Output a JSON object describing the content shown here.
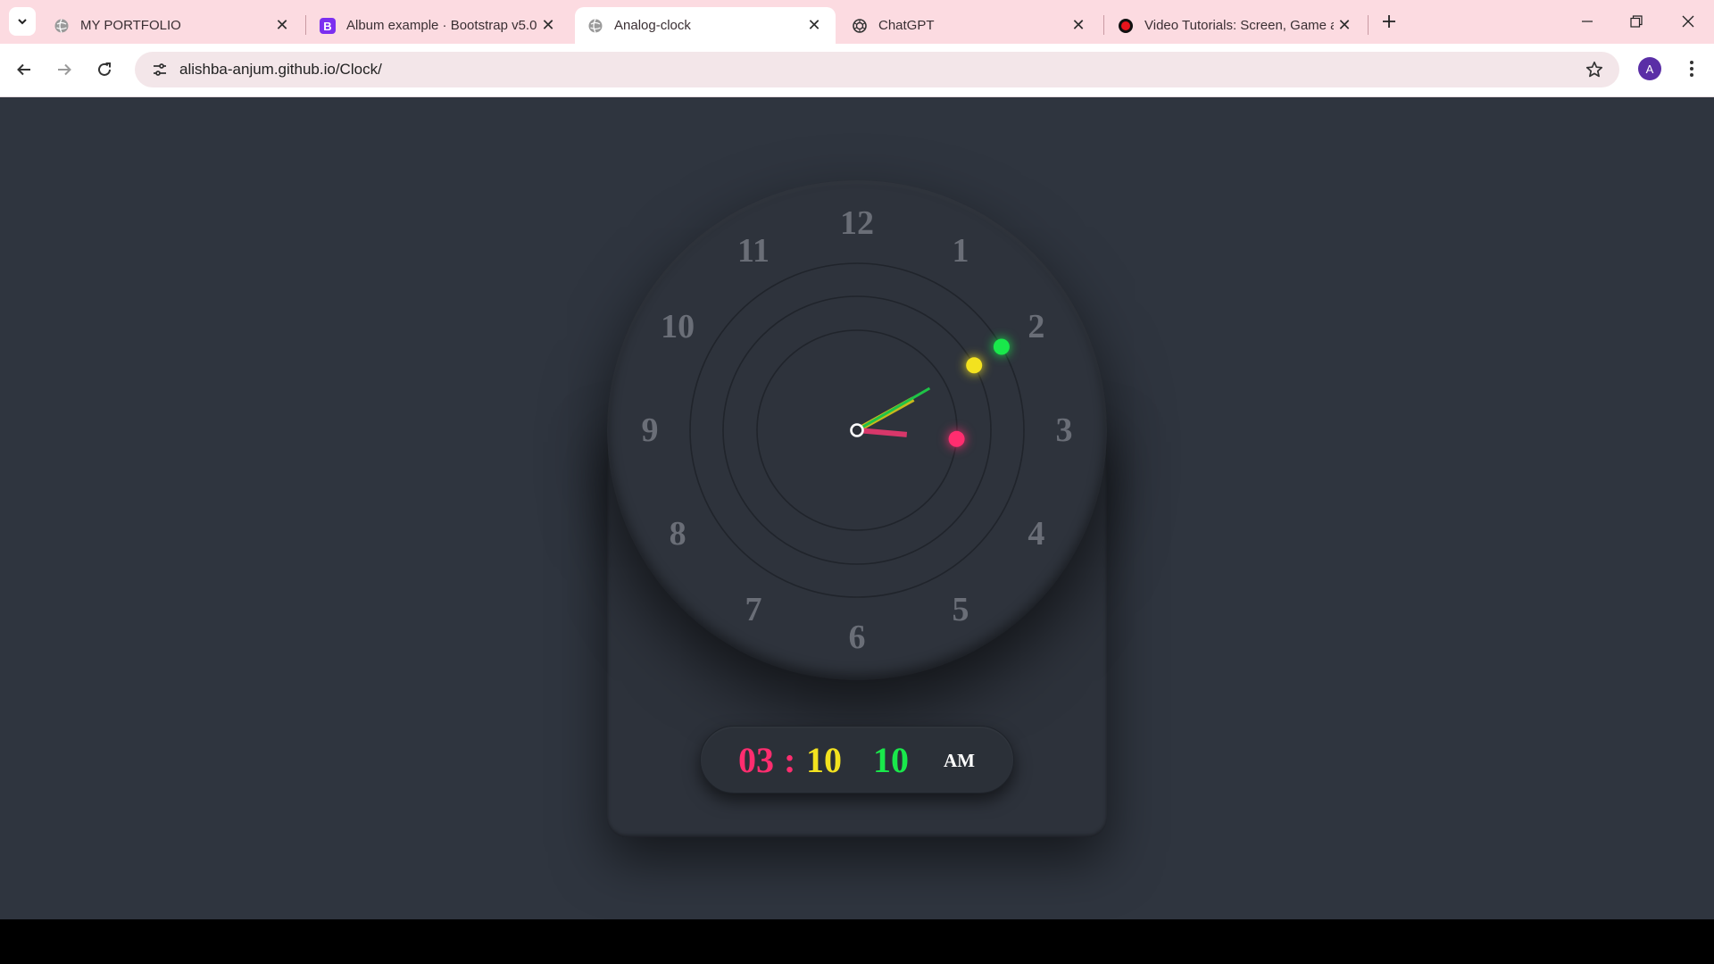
{
  "browser": {
    "tabs": [
      {
        "title": "MY PORTFOLIO",
        "icon": "globe-icon",
        "active": false
      },
      {
        "title": "Album example · Bootstrap v5.0",
        "icon": "bootstrap-icon",
        "active": false
      },
      {
        "title": "Analog-clock",
        "icon": "globe-icon",
        "active": true
      },
      {
        "title": "ChatGPT",
        "icon": "chatgpt-icon",
        "active": false
      },
      {
        "title": "Video Tutorials: Screen, Game a",
        "icon": "record-icon",
        "active": false
      }
    ],
    "url": "alishba-anjum.github.io/Clock/",
    "profile_initial": "A"
  },
  "clock": {
    "numerals": [
      "12",
      "1",
      "2",
      "3",
      "4",
      "5",
      "6",
      "7",
      "8",
      "9",
      "10",
      "11"
    ],
    "colors": {
      "hour": "#ff2d6f",
      "minute": "#f3e21f",
      "second": "#19e84b",
      "numeral": "#6a6e77",
      "background": "#2f353f"
    },
    "digital": {
      "hour": "03",
      "separator": ":",
      "minute": "10",
      "second": "10",
      "period": "AM"
    }
  }
}
